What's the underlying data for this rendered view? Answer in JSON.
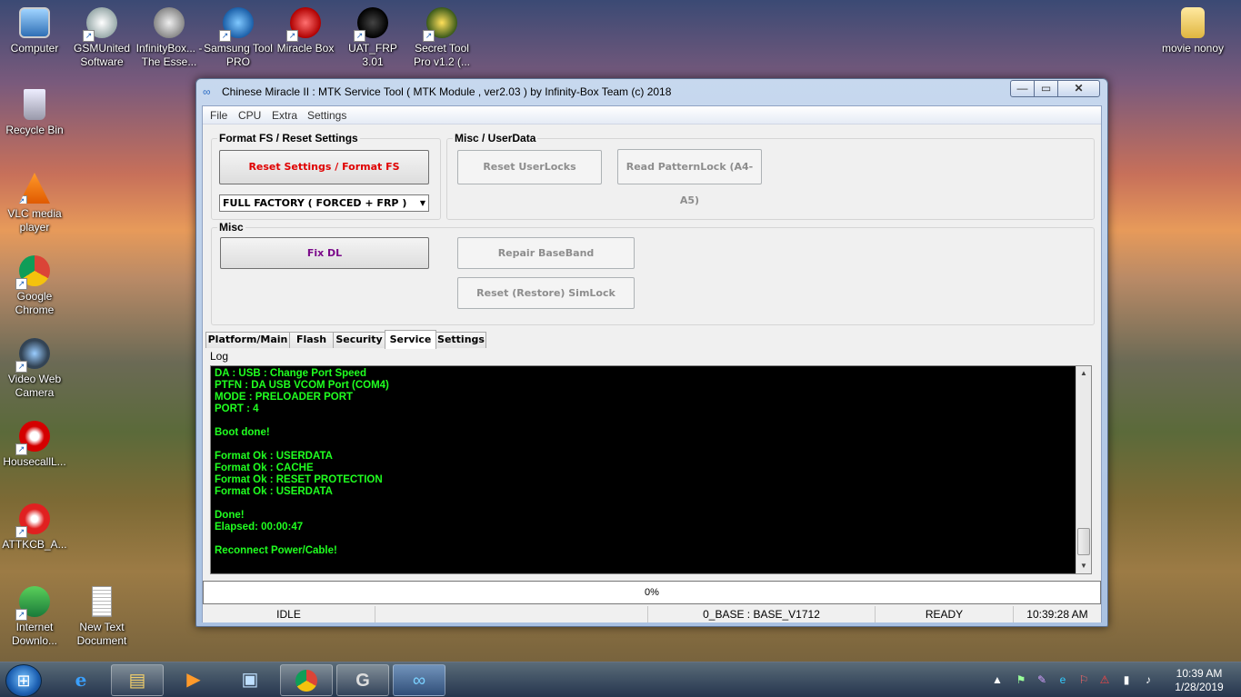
{
  "desktop": {
    "icons": [
      {
        "label": "Computer",
        "icon": "computer-icon"
      },
      {
        "label": "GSMUnited Software",
        "icon": "gsmunited-icon"
      },
      {
        "label": "InfinityBox... - The Esse...",
        "icon": "infinitybox-icon"
      },
      {
        "label": "Samsung Tool PRO",
        "icon": "samsung-tool-icon"
      },
      {
        "label": "Miracle Box",
        "icon": "miracle-box-icon"
      },
      {
        "label": "UAT_FRP 3.01",
        "icon": "uat-frp-icon"
      },
      {
        "label": "Secret Tool Pro v1.2 (...",
        "icon": "secret-tool-icon"
      },
      {
        "label": "movie nonoy",
        "icon": "folder-icon"
      },
      {
        "label": "Recycle Bin",
        "icon": "recycle-bin-icon"
      },
      {
        "label": "VLC media player",
        "icon": "vlc-icon"
      },
      {
        "label": "Google Chrome",
        "icon": "chrome-icon"
      },
      {
        "label": "Video Web Camera",
        "icon": "webcam-icon"
      },
      {
        "label": "HousecallL...",
        "icon": "housecall-icon"
      },
      {
        "label": "ATTKCB_A...",
        "icon": "attk-icon"
      },
      {
        "label": "Internet Downlo...",
        "icon": "idm-icon"
      },
      {
        "label": "New Text Document",
        "icon": "text-document-icon"
      }
    ]
  },
  "window": {
    "title": "Chinese Miracle II : MTK Service Tool ( MTK Module , ver2.03  ) by Infinity-Box Team (c) 2018",
    "minimize": "—",
    "maximize": "▭",
    "close": "✕"
  },
  "menu": [
    "File",
    "CPU",
    "Extra",
    "Settings"
  ],
  "format_group": {
    "title": "Format FS / Reset Settings",
    "reset_button": "Reset Settings / Format FS",
    "mode_select": "FULL FACTORY ( FORCED + FRP )"
  },
  "userdata_group": {
    "title": "Misc  /  UserData",
    "reset_userlocks": "Reset UserLocks",
    "read_patternlock": "Read PatternLock (A4-A5)"
  },
  "misc_group": {
    "title": "Misc",
    "fix_dl": "Fix DL",
    "repair_baseband": "Repair BaseBand",
    "reset_simlock": "Reset (Restore) SimLock"
  },
  "tabs": [
    "Platform/Main",
    "Flash",
    "Security",
    "Service",
    "Settings"
  ],
  "active_tab": "Service",
  "log": {
    "label": "Log",
    "lines": [
      "DA : USB : Change Port Speed",
      "PTFN : DA USB VCOM Port (COM4)",
      "MODE : PRELOADER PORT",
      "PORT : 4",
      "",
      "Boot done!",
      "",
      "Format Ok : USERDATA",
      "Format Ok : CACHE",
      "Format Ok : RESET PROTECTION",
      "Format Ok : USERDATA",
      "",
      "Done!",
      "Elapsed: 00:00:47",
      "",
      "Reconnect Power/Cable!"
    ],
    "text_color": "#20ff20"
  },
  "progress": {
    "text": "0%",
    "value": 0
  },
  "status": {
    "state": "IDLE",
    "base": "0_BASE : BASE_V1712",
    "ready": "READY",
    "time": "10:39:28 AM"
  },
  "taskbar": {
    "clock_time": "10:39 AM",
    "clock_date": "1/28/2019",
    "buttons": [
      "ie-icon",
      "explorer-icon",
      "media-player-icon",
      "remote-desktop-icon",
      "chrome-icon",
      "infinity-g-icon",
      "mtk-icon"
    ]
  }
}
